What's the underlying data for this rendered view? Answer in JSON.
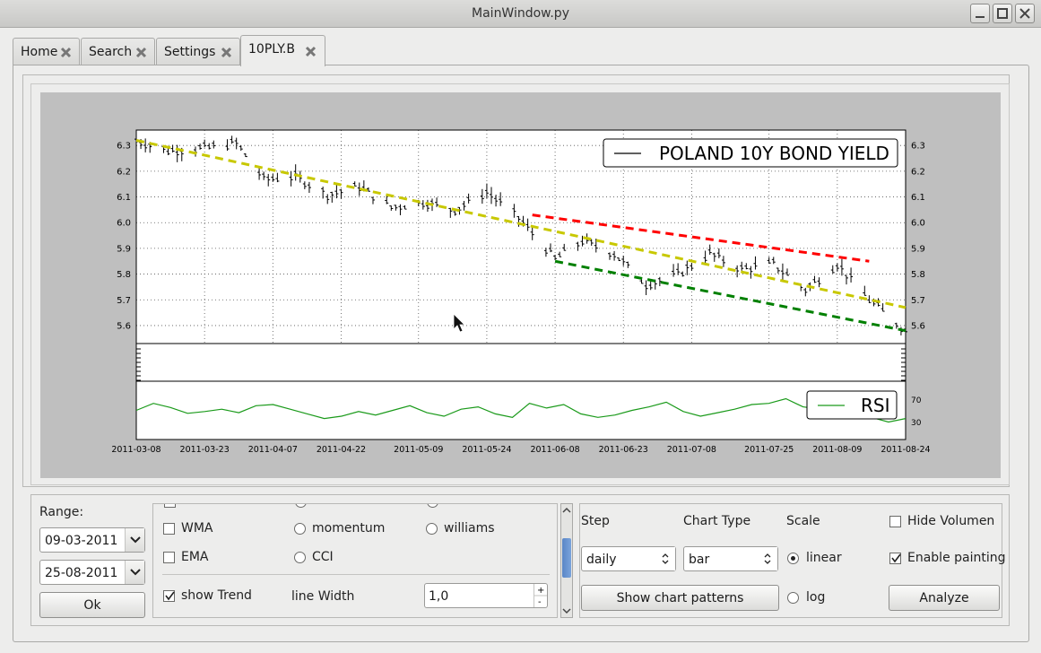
{
  "window": {
    "title": "MainWindow.py"
  },
  "tabs": [
    {
      "label": "Home"
    },
    {
      "label": "Search"
    },
    {
      "label": "Settings"
    },
    {
      "label": "10PLY.B"
    }
  ],
  "chart_data": {
    "type": "line",
    "title": "",
    "legend": [
      "POLAND 10Y BOND YIELD"
    ],
    "legend_position": "top-right",
    "ylim": [
      5.53,
      6.36
    ],
    "yticks": [
      "6.3",
      "6.2",
      "6.1",
      "6.0",
      "5.9",
      "5.8",
      "5.7",
      "5.6"
    ],
    "xticks": [
      "2011-03-08",
      "2011-03-23",
      "2011-04-07",
      "2011-04-22",
      "2011-05-09",
      "2011-05-24",
      "2011-06-08",
      "2011-06-23",
      "2011-07-08",
      "2011-07-25",
      "2011-08-09",
      "2011-08-24"
    ],
    "grid": true,
    "series": [
      {
        "name": "POLAND 10Y BOND YIELD",
        "x": [
          "2011-03-08",
          "2011-03-15",
          "2011-03-23",
          "2011-03-30",
          "2011-04-05",
          "2011-04-12",
          "2011-04-19",
          "2011-04-26",
          "2011-05-03",
          "2011-05-10",
          "2011-05-17",
          "2011-05-24",
          "2011-05-31",
          "2011-06-08",
          "2011-06-14",
          "2011-06-21",
          "2011-06-28",
          "2011-07-05",
          "2011-07-12",
          "2011-07-19",
          "2011-07-26",
          "2011-08-02",
          "2011-08-09",
          "2011-08-16",
          "2011-08-24"
        ],
        "y": [
          6.32,
          6.28,
          6.29,
          6.31,
          6.17,
          6.18,
          6.11,
          6.14,
          6.06,
          6.08,
          6.05,
          6.12,
          6.02,
          5.86,
          5.93,
          5.88,
          5.76,
          5.8,
          5.88,
          5.82,
          5.84,
          5.74,
          5.84,
          5.7,
          5.58
        ]
      }
    ],
    "trend_lines": [
      {
        "color": "#c8c800",
        "from": [
          "2011-03-08",
          6.32
        ],
        "to": [
          "2011-08-24",
          5.67
        ]
      },
      {
        "color": "#ff0000",
        "from": [
          "2011-06-03",
          6.03
        ],
        "to": [
          "2011-08-16",
          5.85
        ]
      },
      {
        "color": "#008000",
        "from": [
          "2011-06-08",
          5.85
        ],
        "to": [
          "2011-08-24",
          5.58
        ]
      }
    ],
    "rsi": {
      "legend": "RSI",
      "yticks": [
        "70",
        "30"
      ],
      "values": [
        50,
        62,
        55,
        45,
        48,
        52,
        46,
        58,
        60,
        52,
        44,
        36,
        40,
        48,
        42,
        50,
        58,
        46,
        40,
        52,
        56,
        44,
        38,
        62,
        54,
        60,
        44,
        38,
        42,
        50,
        56,
        64,
        48,
        40,
        46,
        52,
        60,
        62,
        70,
        56,
        52,
        48,
        44,
        38,
        30,
        36
      ]
    }
  },
  "controls": {
    "range_label": "Range:",
    "date_from": "09-03-2011",
    "date_to": "25-08-2011",
    "ok_button": "Ok",
    "indicators": {
      "wma": "WMA",
      "ema": "EMA",
      "momentum": "momentum",
      "cci": "CCI",
      "williams": "williams",
      "show_trend": "show Trend",
      "line_width_label": "line Width",
      "line_width_value": "1,0"
    },
    "step_label": "Step",
    "step_value": "daily",
    "chart_type_label": "Chart Type",
    "chart_type_value": "bar",
    "scale_label": "Scale",
    "scale_linear": "linear",
    "scale_log": "log",
    "hide_volume": "Hide Volumen",
    "enable_painting": "Enable painting",
    "show_patterns_button": "Show chart patterns",
    "analyze_button": "Analyze"
  }
}
